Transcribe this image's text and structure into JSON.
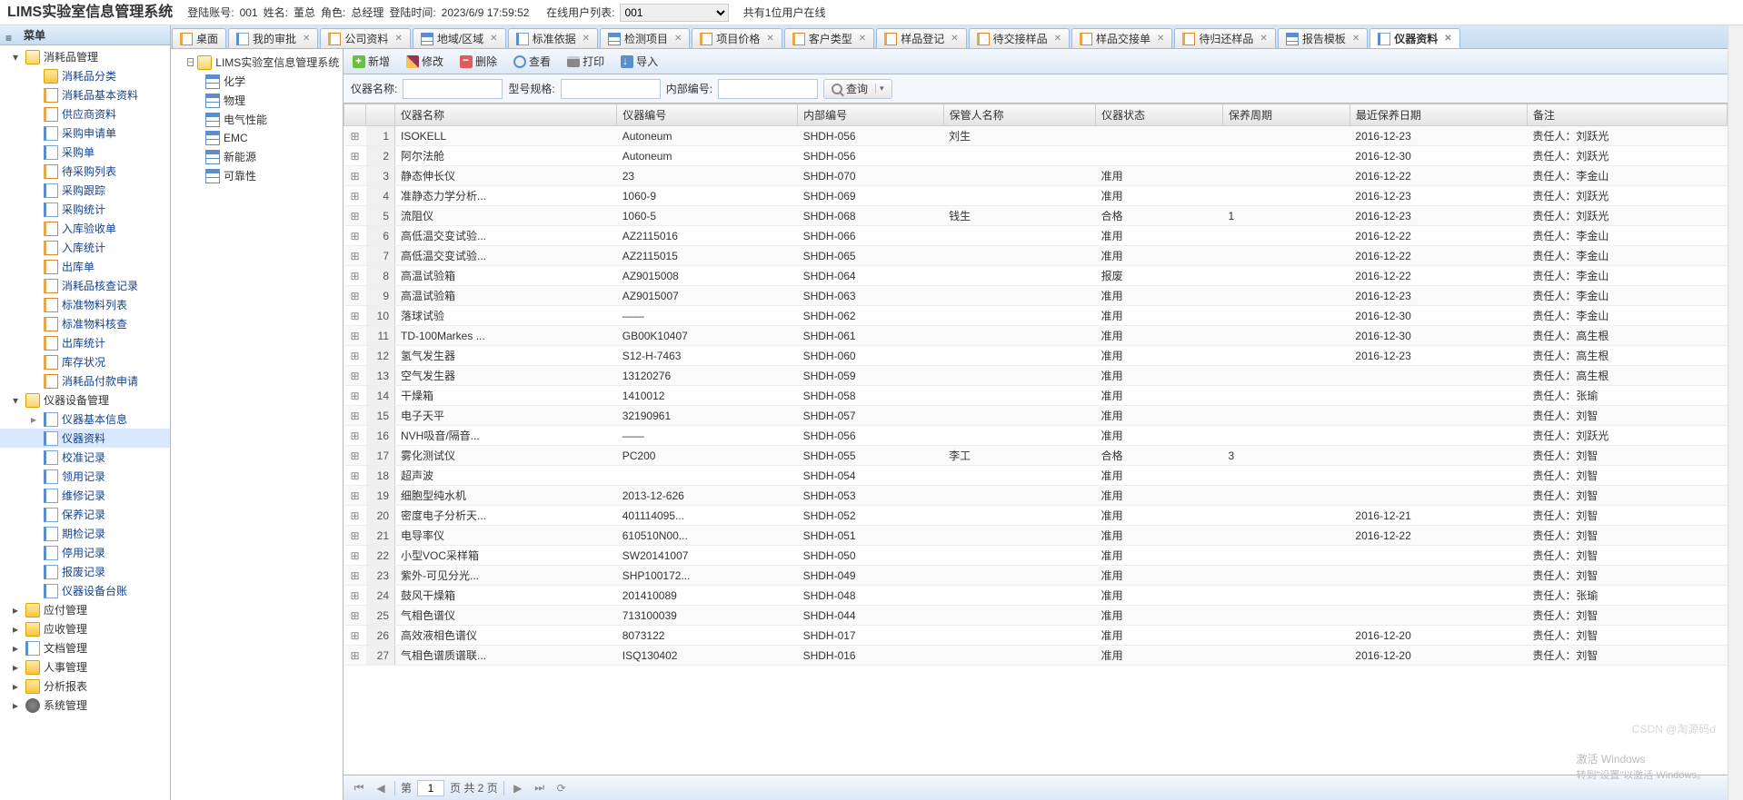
{
  "header": {
    "system_title": "LIMS实验室信息管理系统",
    "login_label": "登陆账号:",
    "login_value": "001",
    "name_label": "姓名:",
    "name_value": "董总",
    "role_label": "角色:",
    "role_value": "总经理",
    "time_label": "登陆时间:",
    "time_value": "2023/6/9 17:59:52",
    "online_label": "在线用户列表:",
    "online_select": "001",
    "online_count": "共有1位用户在线"
  },
  "left_panel": {
    "title": "菜单",
    "nodes": [
      {
        "t": "消耗品管理",
        "ic": "ic-folder-open",
        "lvl": 0,
        "exp": "▾",
        "children": [
          {
            "t": "消耗品分类",
            "ic": "ic-folder"
          },
          {
            "t": "消耗品基本资料",
            "ic": "ic-form"
          },
          {
            "t": "供应商资料",
            "ic": "ic-form"
          },
          {
            "t": "采购申请单",
            "ic": "ic-page"
          },
          {
            "t": "采购单",
            "ic": "ic-page"
          },
          {
            "t": "待采购列表",
            "ic": "ic-form"
          },
          {
            "t": "采购跟踪",
            "ic": "ic-page"
          },
          {
            "t": "采购统计",
            "ic": "ic-page"
          },
          {
            "t": "入库验收单",
            "ic": "ic-form"
          },
          {
            "t": "入库统计",
            "ic": "ic-form"
          },
          {
            "t": "出库单",
            "ic": "ic-form"
          },
          {
            "t": "消耗品核查记录",
            "ic": "ic-form"
          },
          {
            "t": "标准物料列表",
            "ic": "ic-form"
          },
          {
            "t": "标准物料核查",
            "ic": "ic-form"
          },
          {
            "t": "出库统计",
            "ic": "ic-form"
          },
          {
            "t": "库存状况",
            "ic": "ic-form"
          },
          {
            "t": "消耗品付款申请",
            "ic": "ic-form"
          }
        ]
      },
      {
        "t": "仪器设备管理",
        "ic": "ic-folder-open",
        "lvl": 0,
        "exp": "▾",
        "children": [
          {
            "t": "仪器基本信息",
            "ic": "ic-page",
            "pre": "▸"
          },
          {
            "t": "仪器资料",
            "ic": "ic-page",
            "sel": true
          },
          {
            "t": "校准记录",
            "ic": "ic-page"
          },
          {
            "t": "领用记录",
            "ic": "ic-page"
          },
          {
            "t": "维修记录",
            "ic": "ic-page"
          },
          {
            "t": "保养记录",
            "ic": "ic-page"
          },
          {
            "t": "期检记录",
            "ic": "ic-page"
          },
          {
            "t": "停用记录",
            "ic": "ic-page"
          },
          {
            "t": "报废记录",
            "ic": "ic-page"
          },
          {
            "t": "仪器设备台账",
            "ic": "ic-page"
          }
        ]
      },
      {
        "t": "应付管理",
        "ic": "ic-folder",
        "lvl": 0,
        "exp": "▸"
      },
      {
        "t": "应收管理",
        "ic": "ic-folder",
        "lvl": 0,
        "exp": "▸"
      },
      {
        "t": "文档管理",
        "ic": "ic-page",
        "lvl": 0,
        "exp": "▸"
      },
      {
        "t": "人事管理",
        "ic": "ic-folder",
        "lvl": 0,
        "exp": "▸"
      },
      {
        "t": "分析报表",
        "ic": "ic-folder",
        "lvl": 0,
        "exp": "▸"
      },
      {
        "t": "系统管理",
        "ic": "ic-gear",
        "lvl": 0,
        "exp": "▸"
      }
    ]
  },
  "tabs": [
    {
      "t": "桌面",
      "ic": "ic-form",
      "noclose": true
    },
    {
      "t": "我的审批",
      "ic": "ic-page"
    },
    {
      "t": "公司资料",
      "ic": "ic-form"
    },
    {
      "t": "地域/区域",
      "ic": "ic-table"
    },
    {
      "t": "标准依据",
      "ic": "ic-page"
    },
    {
      "t": "检测项目",
      "ic": "ic-table"
    },
    {
      "t": "项目价格",
      "ic": "ic-form"
    },
    {
      "t": "客户类型",
      "ic": "ic-form"
    },
    {
      "t": "样品登记",
      "ic": "ic-form"
    },
    {
      "t": "待交接样品",
      "ic": "ic-form"
    },
    {
      "t": "样品交接单",
      "ic": "ic-form"
    },
    {
      "t": "待归还样品",
      "ic": "ic-form"
    },
    {
      "t": "报告模板",
      "ic": "ic-table"
    },
    {
      "t": "仪器资料",
      "ic": "ic-page",
      "active": true
    }
  ],
  "subtree": {
    "root": "LIMS实验室信息管理系统",
    "items": [
      "化学",
      "物理",
      "电气性能",
      "EMC",
      "新能源",
      "可靠性"
    ]
  },
  "toolbar": {
    "add": "新增",
    "edit": "修改",
    "delete": "删除",
    "view": "查看",
    "print": "打印",
    "import": "导入"
  },
  "search": {
    "name_label": "仪器名称:",
    "model_label": "型号规格:",
    "code_label": "内部编号:",
    "btn": "查询"
  },
  "columns": [
    "仪器名称",
    "仪器编号",
    "内部编号",
    "保管人名称",
    "仪器状态",
    "保养周期",
    "最近保养日期",
    "备注"
  ],
  "rows": [
    [
      "ISOKELL",
      "Autoneum",
      "SHDH-056",
      "刘生",
      "",
      "",
      "2016-12-23",
      "责任人：刘跃光"
    ],
    [
      "阿尔法舱",
      "Autoneum",
      "SHDH-056",
      "",
      "",
      "",
      "2016-12-30",
      "责任人：刘跃光"
    ],
    [
      "静态伸长仪",
      "23",
      "SHDH-070",
      "",
      "准用",
      "",
      "2016-12-22",
      "责任人：李金山"
    ],
    [
      "准静态力学分析...",
      "1060-9",
      "SHDH-069",
      "",
      "准用",
      "",
      "2016-12-23",
      "责任人：刘跃光"
    ],
    [
      "流阻仪",
      "1060-5",
      "SHDH-068",
      "钱生",
      "合格",
      "1",
      "2016-12-23",
      "责任人：刘跃光"
    ],
    [
      "高低温交变试验...",
      "AZ2115016",
      "SHDH-066",
      "",
      "准用",
      "",
      "2016-12-22",
      "责任人：李金山"
    ],
    [
      "高低温交变试验...",
      "AZ2115015",
      "SHDH-065",
      "",
      "准用",
      "",
      "2016-12-22",
      "责任人：李金山"
    ],
    [
      "高温试验箱",
      "AZ9015008",
      "SHDH-064",
      "",
      "报废",
      "",
      "2016-12-22",
      "责任人：李金山"
    ],
    [
      "高温试验箱",
      "AZ9015007",
      "SHDH-063",
      "",
      "准用",
      "",
      "2016-12-23",
      "责任人：李金山"
    ],
    [
      "落球试验",
      "——",
      "SHDH-062",
      "",
      "准用",
      "",
      "2016-12-30",
      "责任人：李金山"
    ],
    [
      "TD-100Markes ...",
      "GB00K10407",
      "SHDH-061",
      "",
      "准用",
      "",
      "2016-12-30",
      "责任人：高生根"
    ],
    [
      "氢气发生器",
      "S12-H-7463",
      "SHDH-060",
      "",
      "准用",
      "",
      "2016-12-23",
      "责任人：高生根"
    ],
    [
      "空气发生器",
      "13120276",
      "SHDH-059",
      "",
      "准用",
      "",
      "",
      "责任人：高生根"
    ],
    [
      "干燥箱",
      "1410012",
      "SHDH-058",
      "",
      "准用",
      "",
      "",
      "责任人：张瑜"
    ],
    [
      "电子天平",
      "32190961",
      "SHDH-057",
      "",
      "准用",
      "",
      "",
      "责任人：刘智"
    ],
    [
      "NVH吸音/隔音...",
      "——",
      "SHDH-056",
      "",
      "准用",
      "",
      "",
      "责任人：刘跃光"
    ],
    [
      "雾化测试仪",
      "PC200",
      "SHDH-055",
      "李工",
      "合格",
      "3",
      "",
      "责任人：刘智"
    ],
    [
      "超声波",
      "",
      "SHDH-054",
      "",
      "准用",
      "",
      "",
      "责任人：刘智"
    ],
    [
      "细胞型纯水机",
      "2013-12-626",
      "SHDH-053",
      "",
      "准用",
      "",
      "",
      "责任人：刘智"
    ],
    [
      "密度电子分析天...",
      "401114095...",
      "SHDH-052",
      "",
      "准用",
      "",
      "2016-12-21",
      "责任人：刘智"
    ],
    [
      "电导率仪",
      "610510N00...",
      "SHDH-051",
      "",
      "准用",
      "",
      "2016-12-22",
      "责任人：刘智"
    ],
    [
      "小型VOC采样箱",
      "SW20141007",
      "SHDH-050",
      "",
      "准用",
      "",
      "",
      "责任人：刘智"
    ],
    [
      "紫外-可见分光...",
      "SHP100172...",
      "SHDH-049",
      "",
      "准用",
      "",
      "",
      "责任人：刘智"
    ],
    [
      "鼓风干燥箱",
      "201410089",
      "SHDH-048",
      "",
      "准用",
      "",
      "",
      "责任人：张瑜"
    ],
    [
      "气相色谱仪",
      "713100039",
      "SHDH-044",
      "",
      "准用",
      "",
      "",
      "责任人：刘智"
    ],
    [
      "高效液相色谱仪",
      "8073122",
      "SHDH-017",
      "",
      "准用",
      "",
      "2016-12-20",
      "责任人：刘智"
    ],
    [
      "气相色谱质谱联...",
      "ISQ130402",
      "SHDH-016",
      "",
      "准用",
      "",
      "2016-12-20",
      "责任人：刘智"
    ]
  ],
  "paging": {
    "page_lbl_pre": "第",
    "page_val": "1",
    "page_lbl_mid": "页 共 2 页"
  },
  "watermark": {
    "line1": "激活 Windows",
    "line2": "转到\"设置\"以激活 Windows。"
  },
  "csdn": "CSDN @淘源码d"
}
